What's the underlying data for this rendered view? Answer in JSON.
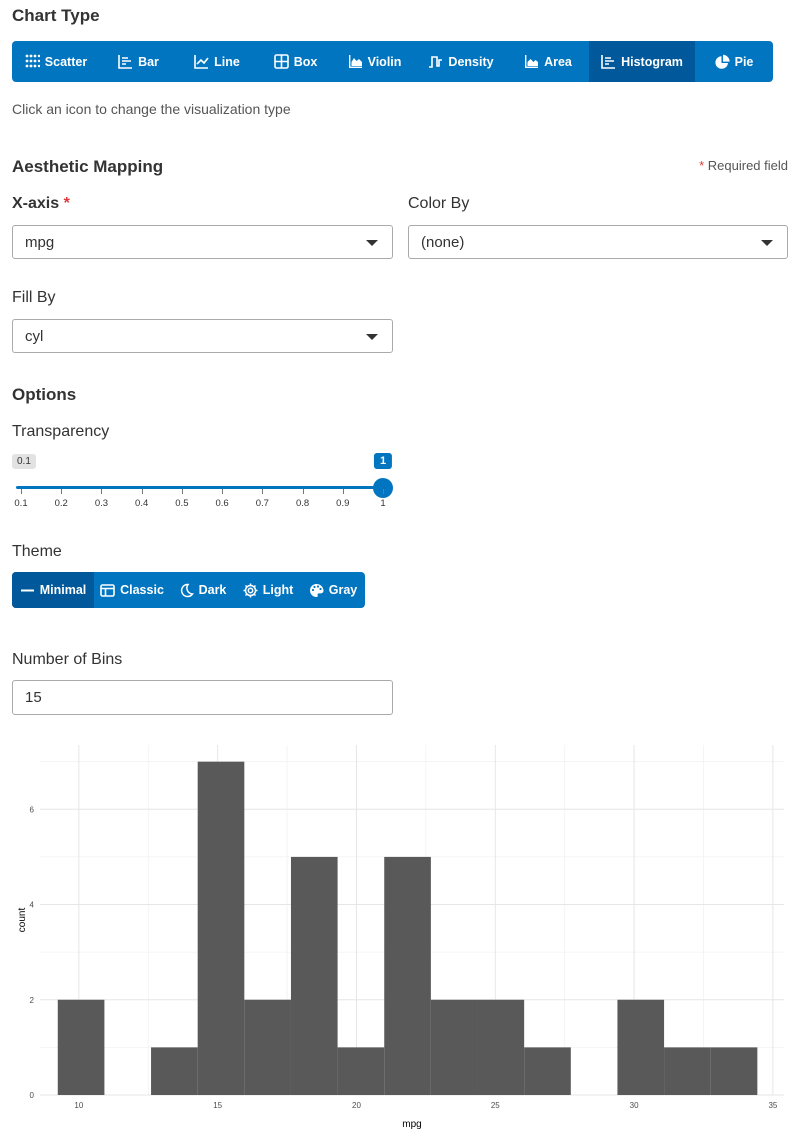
{
  "chart_type": {
    "title": "Chart Type",
    "buttons": [
      {
        "label": "Scatter",
        "icon": "scatter-icon"
      },
      {
        "label": "Bar",
        "icon": "bar-icon"
      },
      {
        "label": "Line",
        "icon": "line-icon"
      },
      {
        "label": "Box",
        "icon": "box-icon"
      },
      {
        "label": "Violin",
        "icon": "violin-icon"
      },
      {
        "label": "Density",
        "icon": "density-icon"
      },
      {
        "label": "Area",
        "icon": "area-icon"
      },
      {
        "label": "Histogram",
        "icon": "histogram-icon"
      },
      {
        "label": "Pie",
        "icon": "pie-icon"
      }
    ],
    "active": "Histogram",
    "help": "Click an icon to change the visualization type"
  },
  "aesthetic": {
    "title": "Aesthetic Mapping",
    "required_note": "Required field",
    "required_star": "*",
    "x_label": "X-axis",
    "x_value": "mpg",
    "color_label": "Color By",
    "color_value": "(none)",
    "fill_label": "Fill By",
    "fill_value": "cyl"
  },
  "options": {
    "title": "Options",
    "transparency_label": "Transparency",
    "slider_min": "0.1",
    "slider_value": "1",
    "slider_fraction": 1.0,
    "ticks": [
      "0.1",
      "0.2",
      "0.3",
      "0.4",
      "0.5",
      "0.6",
      "0.7",
      "0.8",
      "0.9",
      "1"
    ],
    "theme_label": "Theme",
    "themes": [
      {
        "label": "Minimal",
        "icon": "minus-icon"
      },
      {
        "label": "Classic",
        "icon": "window-icon"
      },
      {
        "label": "Dark",
        "icon": "moon-icon"
      },
      {
        "label": "Light",
        "icon": "gear-icon"
      },
      {
        "label": "Gray",
        "icon": "palette-icon"
      }
    ],
    "active_theme": "Minimal",
    "bins_label": "Number of Bins",
    "bins_value": "15"
  },
  "colors": {
    "accent": "#0275c1",
    "accent_active": "#01589a",
    "bar": "#595959",
    "required": "#e03a3a"
  },
  "chart_data": {
    "type": "bar",
    "xlabel": "mpg",
    "ylabel": "count",
    "xlim": [
      8.6,
      35.4
    ],
    "ylim": [
      0,
      7.35
    ],
    "x_ticks": [
      10,
      15,
      20,
      25,
      30,
      35
    ],
    "y_ticks": [
      0,
      2,
      4,
      6
    ],
    "bins": [
      {
        "x0": 9.24,
        "x1": 10.92,
        "count": 2
      },
      {
        "x0": 10.92,
        "x1": 12.6,
        "count": 0
      },
      {
        "x0": 12.6,
        "x1": 14.28,
        "count": 1
      },
      {
        "x0": 14.28,
        "x1": 15.96,
        "count": 7
      },
      {
        "x0": 15.96,
        "x1": 17.64,
        "count": 2
      },
      {
        "x0": 17.64,
        "x1": 19.32,
        "count": 5
      },
      {
        "x0": 19.32,
        "x1": 21.0,
        "count": 1
      },
      {
        "x0": 21.0,
        "x1": 22.68,
        "count": 5
      },
      {
        "x0": 22.68,
        "x1": 24.36,
        "count": 2
      },
      {
        "x0": 24.36,
        "x1": 26.04,
        "count": 2
      },
      {
        "x0": 26.04,
        "x1": 27.72,
        "count": 1
      },
      {
        "x0": 27.72,
        "x1": 29.4,
        "count": 0
      },
      {
        "x0": 29.4,
        "x1": 31.08,
        "count": 2
      },
      {
        "x0": 31.08,
        "x1": 32.76,
        "count": 1
      },
      {
        "x0": 32.76,
        "x1": 34.44,
        "count": 1
      }
    ],
    "grid": true
  }
}
